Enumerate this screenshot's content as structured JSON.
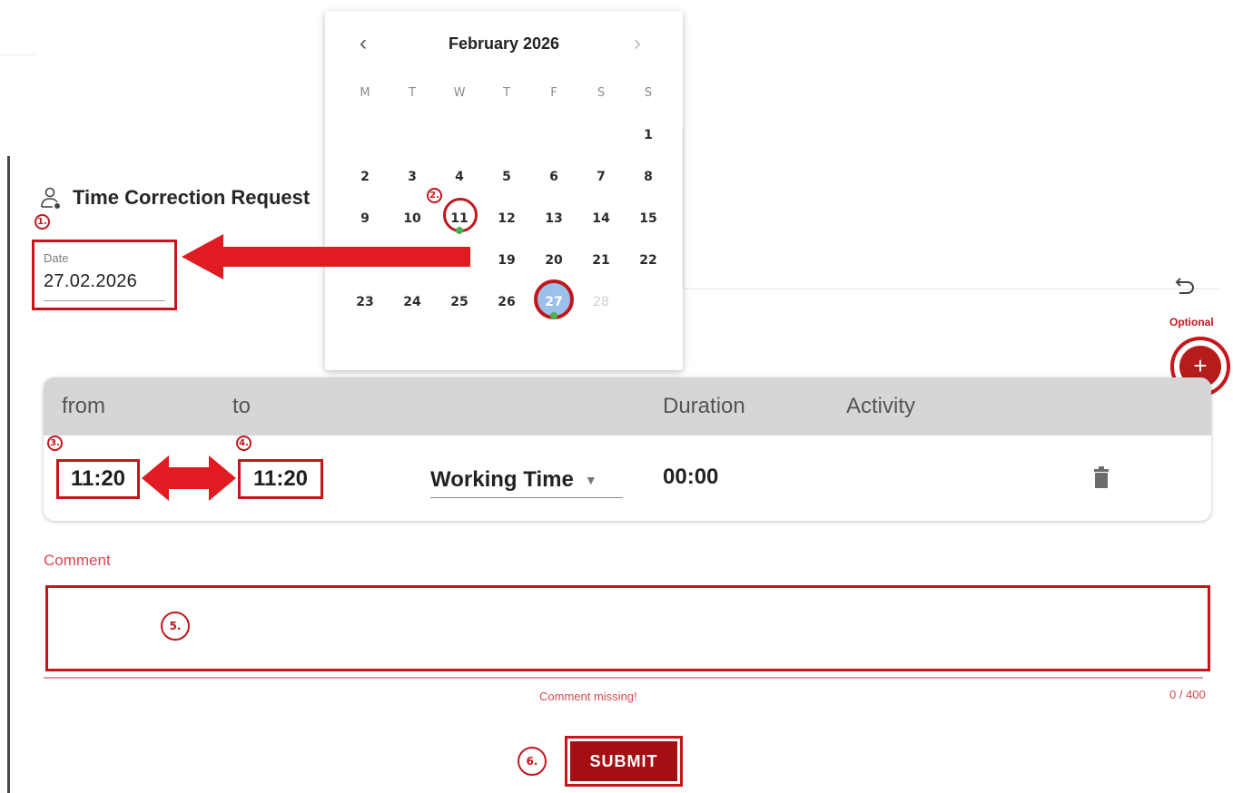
{
  "page": {
    "title": "Time Correction Request"
  },
  "annotations": {
    "m1": "1.",
    "m2": "2.",
    "m3": "3.",
    "m4": "4.",
    "m5": "5.",
    "m6": "6."
  },
  "date_field": {
    "label": "Date",
    "value": "27.02.2026"
  },
  "calendar": {
    "month_label": "February 2026",
    "weekdays": [
      "M",
      "T",
      "W",
      "T",
      "F",
      "S",
      "S"
    ],
    "weeks": [
      [
        "",
        "",
        "",
        "",
        "",
        "",
        "1"
      ],
      [
        "2",
        "3",
        "4",
        "5",
        "6",
        "7",
        "8"
      ],
      [
        "9",
        "10",
        "11",
        "12",
        "13",
        "14",
        "15"
      ],
      [
        "",
        "",
        "",
        "19",
        "20",
        "21",
        "22"
      ],
      [
        "23",
        "24",
        "25",
        "26",
        "27",
        "28",
        ""
      ]
    ],
    "marked_day": "11",
    "selected_day": "27",
    "disabled_day": "28"
  },
  "actions": {
    "optional_label": "Optional",
    "add_symbol": "+"
  },
  "table": {
    "headers": {
      "from": "from",
      "to": "to",
      "duration": "Duration",
      "activity": "Activity"
    },
    "row": {
      "from": "11:20",
      "to": "11:20",
      "activity": "Working Time",
      "duration": "00:00"
    }
  },
  "comment": {
    "label": "Comment",
    "value": "",
    "error": "Comment missing!",
    "counter": "0 / 400"
  },
  "submit": {
    "label": "SUBMIT"
  },
  "colors": {
    "annotation_red": "#c7151b",
    "button_red": "#a50f14",
    "selected_day_blue": "#9cc0ec",
    "dot_green": "#4caf50",
    "table_header_gray": "#d6d6d6"
  }
}
